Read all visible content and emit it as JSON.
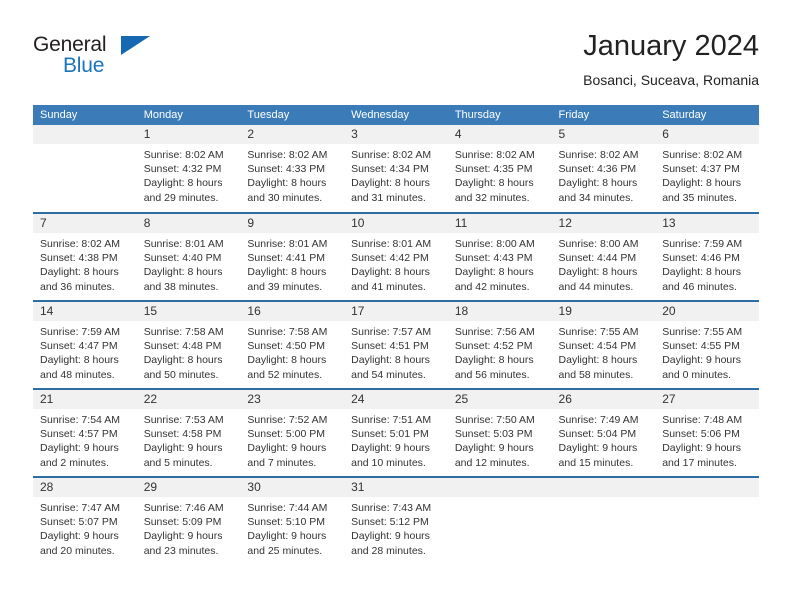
{
  "brand": {
    "name_top": "General",
    "name_bottom": "Blue",
    "color_blue": "#1b75bc",
    "color_triangle": "#1668b3"
  },
  "header": {
    "title": "January 2024",
    "subtitle": "Bosanci, Suceava, Romania"
  },
  "theme": {
    "header_bg": "#3b7cb8",
    "row_rule": "#2e6da4",
    "daynum_bg": "#f1f1f1"
  },
  "weekday_headers": [
    "Sunday",
    "Monday",
    "Tuesday",
    "Wednesday",
    "Thursday",
    "Friday",
    "Saturday"
  ],
  "weeks": [
    [
      {
        "day": "",
        "sunrise": "",
        "sunset": "",
        "daylight_line1": "",
        "daylight_line2": "",
        "empty": true
      },
      {
        "day": "1",
        "sunrise": "Sunrise: 8:02 AM",
        "sunset": "Sunset: 4:32 PM",
        "daylight_line1": "Daylight: 8 hours",
        "daylight_line2": "and 29 minutes."
      },
      {
        "day": "2",
        "sunrise": "Sunrise: 8:02 AM",
        "sunset": "Sunset: 4:33 PM",
        "daylight_line1": "Daylight: 8 hours",
        "daylight_line2": "and 30 minutes."
      },
      {
        "day": "3",
        "sunrise": "Sunrise: 8:02 AM",
        "sunset": "Sunset: 4:34 PM",
        "daylight_line1": "Daylight: 8 hours",
        "daylight_line2": "and 31 minutes."
      },
      {
        "day": "4",
        "sunrise": "Sunrise: 8:02 AM",
        "sunset": "Sunset: 4:35 PM",
        "daylight_line1": "Daylight: 8 hours",
        "daylight_line2": "and 32 minutes."
      },
      {
        "day": "5",
        "sunrise": "Sunrise: 8:02 AM",
        "sunset": "Sunset: 4:36 PM",
        "daylight_line1": "Daylight: 8 hours",
        "daylight_line2": "and 34 minutes."
      },
      {
        "day": "6",
        "sunrise": "Sunrise: 8:02 AM",
        "sunset": "Sunset: 4:37 PM",
        "daylight_line1": "Daylight: 8 hours",
        "daylight_line2": "and 35 minutes."
      }
    ],
    [
      {
        "day": "7",
        "sunrise": "Sunrise: 8:02 AM",
        "sunset": "Sunset: 4:38 PM",
        "daylight_line1": "Daylight: 8 hours",
        "daylight_line2": "and 36 minutes."
      },
      {
        "day": "8",
        "sunrise": "Sunrise: 8:01 AM",
        "sunset": "Sunset: 4:40 PM",
        "daylight_line1": "Daylight: 8 hours",
        "daylight_line2": "and 38 minutes."
      },
      {
        "day": "9",
        "sunrise": "Sunrise: 8:01 AM",
        "sunset": "Sunset: 4:41 PM",
        "daylight_line1": "Daylight: 8 hours",
        "daylight_line2": "and 39 minutes."
      },
      {
        "day": "10",
        "sunrise": "Sunrise: 8:01 AM",
        "sunset": "Sunset: 4:42 PM",
        "daylight_line1": "Daylight: 8 hours",
        "daylight_line2": "and 41 minutes."
      },
      {
        "day": "11",
        "sunrise": "Sunrise: 8:00 AM",
        "sunset": "Sunset: 4:43 PM",
        "daylight_line1": "Daylight: 8 hours",
        "daylight_line2": "and 42 minutes."
      },
      {
        "day": "12",
        "sunrise": "Sunrise: 8:00 AM",
        "sunset": "Sunset: 4:44 PM",
        "daylight_line1": "Daylight: 8 hours",
        "daylight_line2": "and 44 minutes."
      },
      {
        "day": "13",
        "sunrise": "Sunrise: 7:59 AM",
        "sunset": "Sunset: 4:46 PM",
        "daylight_line1": "Daylight: 8 hours",
        "daylight_line2": "and 46 minutes."
      }
    ],
    [
      {
        "day": "14",
        "sunrise": "Sunrise: 7:59 AM",
        "sunset": "Sunset: 4:47 PM",
        "daylight_line1": "Daylight: 8 hours",
        "daylight_line2": "and 48 minutes."
      },
      {
        "day": "15",
        "sunrise": "Sunrise: 7:58 AM",
        "sunset": "Sunset: 4:48 PM",
        "daylight_line1": "Daylight: 8 hours",
        "daylight_line2": "and 50 minutes."
      },
      {
        "day": "16",
        "sunrise": "Sunrise: 7:58 AM",
        "sunset": "Sunset: 4:50 PM",
        "daylight_line1": "Daylight: 8 hours",
        "daylight_line2": "and 52 minutes."
      },
      {
        "day": "17",
        "sunrise": "Sunrise: 7:57 AM",
        "sunset": "Sunset: 4:51 PM",
        "daylight_line1": "Daylight: 8 hours",
        "daylight_line2": "and 54 minutes."
      },
      {
        "day": "18",
        "sunrise": "Sunrise: 7:56 AM",
        "sunset": "Sunset: 4:52 PM",
        "daylight_line1": "Daylight: 8 hours",
        "daylight_line2": "and 56 minutes."
      },
      {
        "day": "19",
        "sunrise": "Sunrise: 7:55 AM",
        "sunset": "Sunset: 4:54 PM",
        "daylight_line1": "Daylight: 8 hours",
        "daylight_line2": "and 58 minutes."
      },
      {
        "day": "20",
        "sunrise": "Sunrise: 7:55 AM",
        "sunset": "Sunset: 4:55 PM",
        "daylight_line1": "Daylight: 9 hours",
        "daylight_line2": "and 0 minutes."
      }
    ],
    [
      {
        "day": "21",
        "sunrise": "Sunrise: 7:54 AM",
        "sunset": "Sunset: 4:57 PM",
        "daylight_line1": "Daylight: 9 hours",
        "daylight_line2": "and 2 minutes."
      },
      {
        "day": "22",
        "sunrise": "Sunrise: 7:53 AM",
        "sunset": "Sunset: 4:58 PM",
        "daylight_line1": "Daylight: 9 hours",
        "daylight_line2": "and 5 minutes."
      },
      {
        "day": "23",
        "sunrise": "Sunrise: 7:52 AM",
        "sunset": "Sunset: 5:00 PM",
        "daylight_line1": "Daylight: 9 hours",
        "daylight_line2": "and 7 minutes."
      },
      {
        "day": "24",
        "sunrise": "Sunrise: 7:51 AM",
        "sunset": "Sunset: 5:01 PM",
        "daylight_line1": "Daylight: 9 hours",
        "daylight_line2": "and 10 minutes."
      },
      {
        "day": "25",
        "sunrise": "Sunrise: 7:50 AM",
        "sunset": "Sunset: 5:03 PM",
        "daylight_line1": "Daylight: 9 hours",
        "daylight_line2": "and 12 minutes."
      },
      {
        "day": "26",
        "sunrise": "Sunrise: 7:49 AM",
        "sunset": "Sunset: 5:04 PM",
        "daylight_line1": "Daylight: 9 hours",
        "daylight_line2": "and 15 minutes."
      },
      {
        "day": "27",
        "sunrise": "Sunrise: 7:48 AM",
        "sunset": "Sunset: 5:06 PM",
        "daylight_line1": "Daylight: 9 hours",
        "daylight_line2": "and 17 minutes."
      }
    ],
    [
      {
        "day": "28",
        "sunrise": "Sunrise: 7:47 AM",
        "sunset": "Sunset: 5:07 PM",
        "daylight_line1": "Daylight: 9 hours",
        "daylight_line2": "and 20 minutes."
      },
      {
        "day": "29",
        "sunrise": "Sunrise: 7:46 AM",
        "sunset": "Sunset: 5:09 PM",
        "daylight_line1": "Daylight: 9 hours",
        "daylight_line2": "and 23 minutes."
      },
      {
        "day": "30",
        "sunrise": "Sunrise: 7:44 AM",
        "sunset": "Sunset: 5:10 PM",
        "daylight_line1": "Daylight: 9 hours",
        "daylight_line2": "and 25 minutes."
      },
      {
        "day": "31",
        "sunrise": "Sunrise: 7:43 AM",
        "sunset": "Sunset: 5:12 PM",
        "daylight_line1": "Daylight: 9 hours",
        "daylight_line2": "and 28 minutes."
      },
      {
        "day": "",
        "sunrise": "",
        "sunset": "",
        "daylight_line1": "",
        "daylight_line2": "",
        "empty": true
      },
      {
        "day": "",
        "sunrise": "",
        "sunset": "",
        "daylight_line1": "",
        "daylight_line2": "",
        "empty": true
      },
      {
        "day": "",
        "sunrise": "",
        "sunset": "",
        "daylight_line1": "",
        "daylight_line2": "",
        "empty": true
      }
    ]
  ]
}
